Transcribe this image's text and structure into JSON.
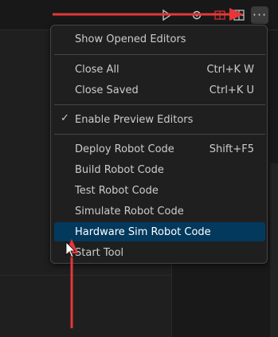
{
  "menu": {
    "items": [
      {
        "label": "Show Opened Editors",
        "shortcut": ""
      },
      {
        "label": "Close All",
        "shortcut": "Ctrl+K W"
      },
      {
        "label": "Close Saved",
        "shortcut": "Ctrl+K U"
      },
      {
        "label": "Enable Preview Editors",
        "shortcut": ""
      },
      {
        "label": "Deploy Robot Code",
        "shortcut": "Shift+F5"
      },
      {
        "label": "Build Robot Code",
        "shortcut": ""
      },
      {
        "label": "Test Robot Code",
        "shortcut": ""
      },
      {
        "label": "Simulate Robot Code",
        "shortcut": ""
      },
      {
        "label": "Hardware Sim Robot Code",
        "shortcut": ""
      },
      {
        "label": "Start Tool",
        "shortcut": ""
      }
    ],
    "checked_item": "Enable Preview Editors",
    "highlighted_item": "Hardware Sim Robot Code"
  },
  "toolbar": {
    "icons": [
      "run-icon",
      "settings-gear-icon",
      "split-editor-icon",
      "layout-icon",
      "more-actions-icon"
    ]
  },
  "colors": {
    "menu_bg": "#1f1f1f",
    "highlight": "#04395e",
    "arrow_annotation": "#e5373a"
  }
}
